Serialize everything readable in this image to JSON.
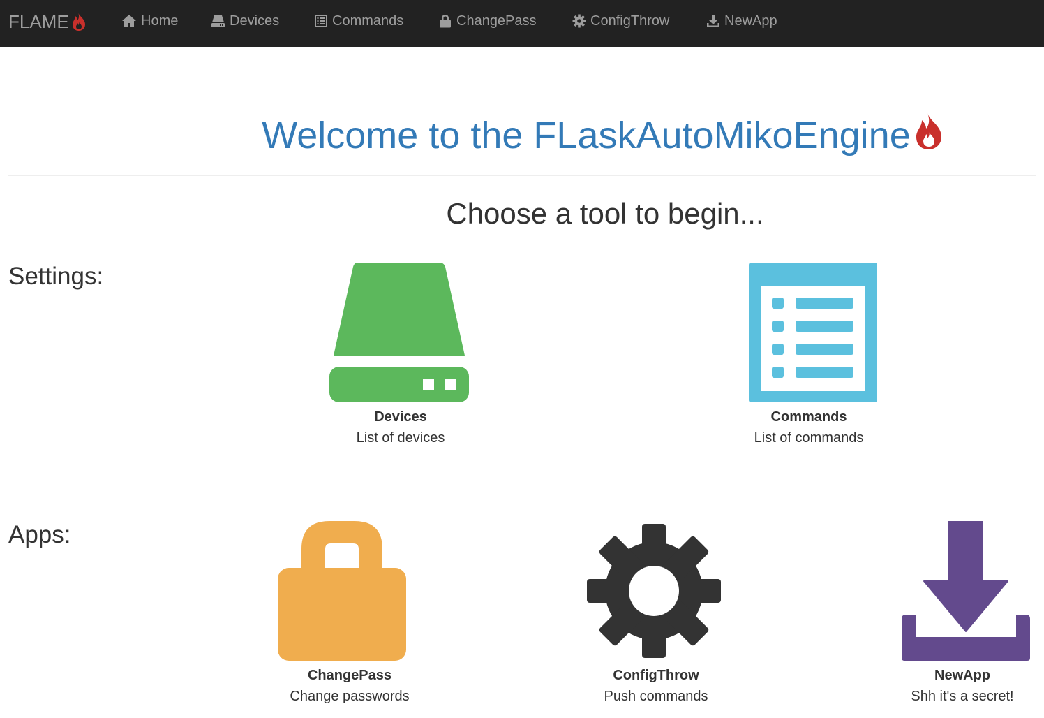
{
  "navbar": {
    "brand": "FLAME",
    "items": [
      {
        "label": "Home",
        "icon": "home-icon"
      },
      {
        "label": "Devices",
        "icon": "hdd-icon"
      },
      {
        "label": "Commands",
        "icon": "list-alt-icon"
      },
      {
        "label": "ChangePass",
        "icon": "lock-icon"
      },
      {
        "label": "ConfigThrow",
        "icon": "cog-icon"
      },
      {
        "label": "NewApp",
        "icon": "download-icon"
      }
    ]
  },
  "main": {
    "welcome": "Welcome to the FLaskAutoMikoEngine",
    "subtitle": "Choose a tool to begin...",
    "settings_label": "Settings:",
    "apps_label": "Apps:",
    "settings": [
      {
        "name": "Devices",
        "desc": "List of devices",
        "icon": "hdd-icon",
        "color": "#5cb85c"
      },
      {
        "name": "Commands",
        "desc": "List of commands",
        "icon": "list-alt-icon",
        "color": "#5bc0de"
      }
    ],
    "apps": [
      {
        "name": "ChangePass",
        "desc": "Change passwords",
        "icon": "lock-icon",
        "color": "#f0ad4e"
      },
      {
        "name": "ConfigThrow",
        "desc": "Push commands",
        "icon": "cog-icon",
        "color": "#333333"
      },
      {
        "name": "NewApp",
        "desc": "Shh it's a secret!",
        "icon": "download-icon",
        "color": "#634a8d"
      }
    ]
  },
  "colors": {
    "navbar_bg": "#222222",
    "navbar_text": "#9d9d9d",
    "link_blue": "#337ab7",
    "flame_red": "#c9302c"
  }
}
